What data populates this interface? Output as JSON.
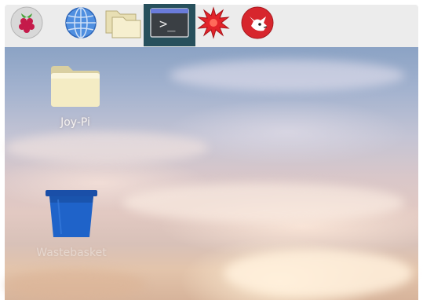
{
  "taskbar": {
    "items": [
      {
        "icon": "raspberry-pi-menu-icon",
        "active": false
      },
      {
        "icon": "web-browser-icon",
        "active": false
      },
      {
        "icon": "file-manager-icon",
        "active": false
      },
      {
        "icon": "terminal-icon",
        "active": true,
        "glyph": ">_"
      },
      {
        "icon": "math-kernel-burst-icon",
        "active": false
      },
      {
        "icon": "wolfram-icon",
        "active": false
      }
    ],
    "active_color": "#27505c"
  },
  "desktop": {
    "icons": [
      {
        "icon": "folder-icon",
        "label": "Joy-Pi"
      },
      {
        "icon": "trash-can-icon",
        "label": "Wastebasket"
      }
    ]
  }
}
